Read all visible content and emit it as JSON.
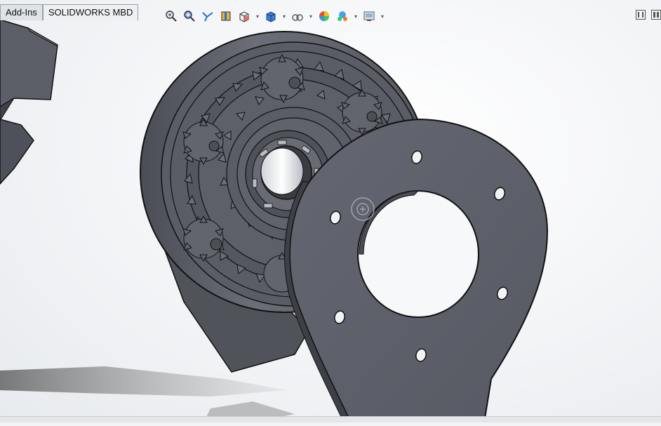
{
  "tabs": [
    {
      "label": "Add-Ins"
    },
    {
      "label": "SOLIDWORKS MBD"
    }
  ],
  "heads_up_toolbar": [
    {
      "icon": "zoom-to-fit-icon"
    },
    {
      "icon": "zoom-to-area-icon"
    },
    {
      "icon": "previous-view-icon"
    },
    {
      "icon": "section-view-icon"
    },
    {
      "icon": "view-orientation-icon"
    },
    {
      "icon": "display-style-icon"
    },
    {
      "icon": "hide-show-items-icon"
    },
    {
      "icon": "edit-appearance-icon"
    },
    {
      "icon": "apply-scene-icon"
    },
    {
      "icon": "view-settings-icon"
    }
  ],
  "window_buttons": [
    {
      "icon": "tile-horizontal-icon"
    },
    {
      "icon": "tile-vertical-icon"
    }
  ],
  "colors": {
    "part_face": "#5c5f68",
    "part_dark": "#3a3c42",
    "edge": "#111111",
    "viewport_bg": "#f4f5f7"
  }
}
